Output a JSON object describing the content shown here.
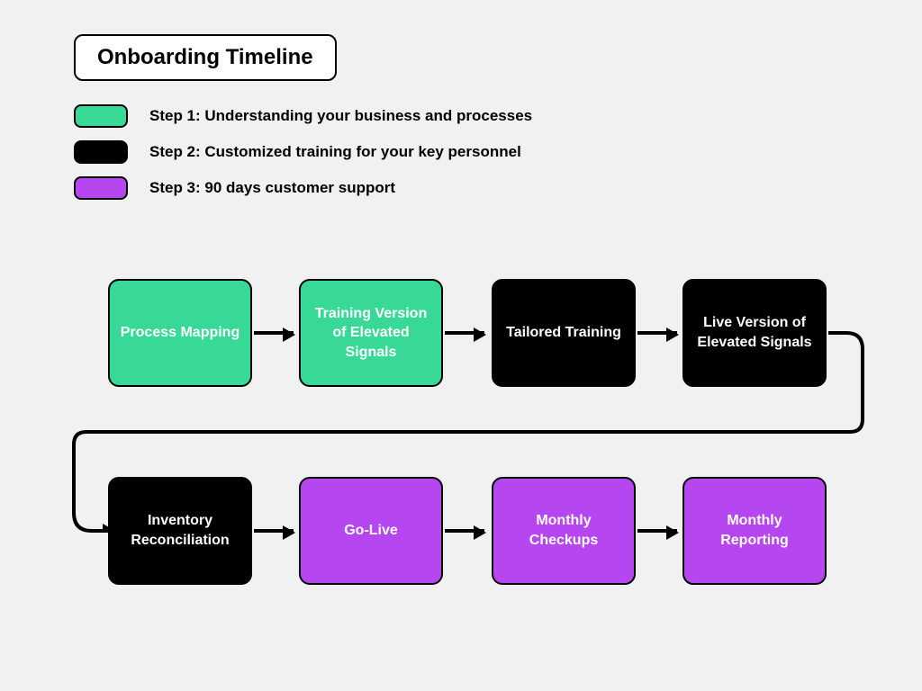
{
  "title": "Onboarding Timeline",
  "legend": {
    "step1": "Step 1: Understanding your business and processes",
    "step2": "Step 2: Customized training for your key personnel",
    "step3": "Step 3: 90 days customer support"
  },
  "boxes": {
    "b1": "Process Mapping",
    "b2": "Training Version of Elevated Signals",
    "b3": "Tailored Training",
    "b4": "Live Version of Elevated Signals",
    "b5": "Inventory Reconciliation",
    "b6": "Go-Live",
    "b7": "Monthly Checkups",
    "b8": "Monthly Reporting"
  },
  "colors": {
    "green": "#38d996",
    "black": "#000000",
    "purple": "#b546f0"
  }
}
